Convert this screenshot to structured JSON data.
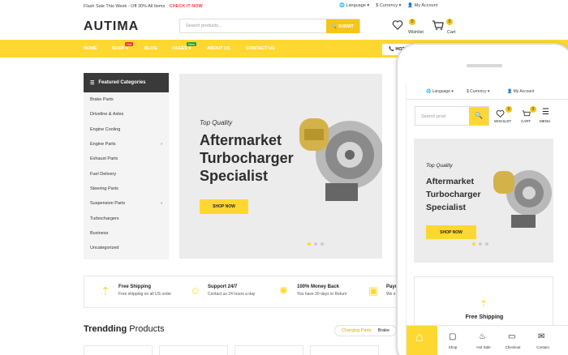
{
  "topbar": {
    "promo": "Flash Sale This Week - Off 30% All Items",
    "cta": "CHECK IT NOW",
    "language": "Language",
    "currency": "Currency",
    "account": "My Account"
  },
  "header": {
    "logo": "AUTIMA",
    "search_placeholder": "Search products...",
    "search_button": "SUBMIT",
    "wishlist_label": "Wishlist",
    "wishlist_count": "0",
    "cart_label": "Cart",
    "cart_count": "0"
  },
  "nav": {
    "items": [
      "HOME",
      "SHOP",
      "BLOG",
      "PAGES",
      "ABOUT US",
      "CONTACT US"
    ],
    "shop_tag": "Hot",
    "pages_tag": "New",
    "hotline": "HOT"
  },
  "sidebar": {
    "title": "Featured Categories",
    "items": [
      "Brake Parts",
      "Driveline & Axles",
      "Engine Cooling",
      "Engine Parts",
      "Exhaust Parts",
      "Fuel Delivery",
      "Steering Parts",
      "Suspension Parts",
      "Turbochargers",
      "Business",
      "Uncategorized"
    ]
  },
  "hero": {
    "subtitle": "Top Quality",
    "title": "Aftermarket Turbocharger Specialist",
    "button": "SHOP NOW"
  },
  "features": [
    {
      "title": "Free Shipping",
      "desc": "Free shipping on all US order"
    },
    {
      "title": "Support 24/7",
      "desc": "Contact us 24 hours a day"
    },
    {
      "title": "100% Money Back",
      "desc": "You have 30 days to Return"
    },
    {
      "title": "Payı",
      "desc": "We e"
    }
  ],
  "trending": {
    "title_a": "Trendding",
    "title_b": "Products",
    "tabs": [
      "Charging Parts",
      "Brake"
    ]
  },
  "mobile": {
    "language": "Language",
    "currency": "Currency",
    "account": "My Account",
    "search_placeholder": "Search prod",
    "wishlist_label": "WISHLIST",
    "wishlist_count": "0",
    "cart_label": "CART",
    "cart_count": "0",
    "menu_label": "MENU",
    "hero_subtitle": "Top Quality",
    "hero_title": "Aftermarket Turbocharger Specialist",
    "hero_button": "SHOP NOW",
    "card_title": "Free Shipping",
    "bottom_items": [
      "Shop",
      "Hot Sale",
      "Checkout",
      "Contact"
    ]
  },
  "colors": {
    "accent": "#fed830",
    "dark": "#3a3a3a"
  }
}
